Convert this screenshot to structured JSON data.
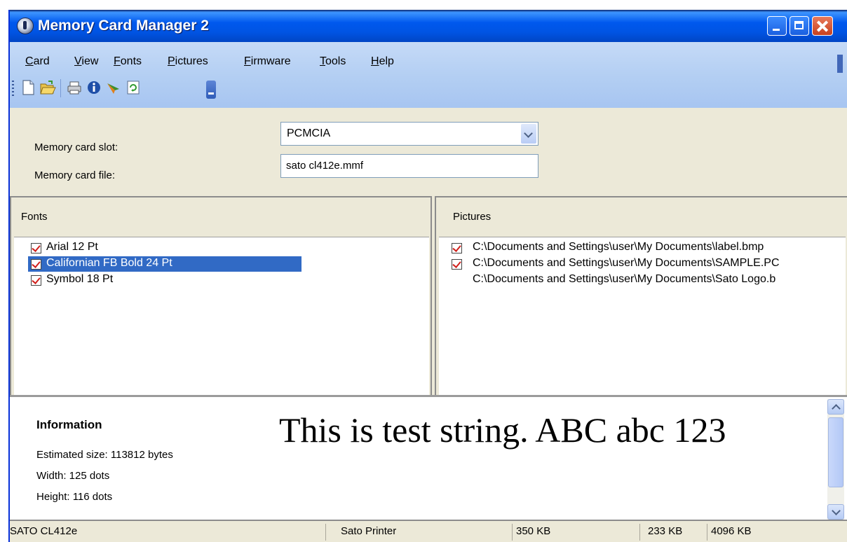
{
  "window": {
    "title": "Memory Card Manager 2"
  },
  "menu": [
    "Card",
    "View",
    "Fonts",
    "Pictures",
    "Firmware",
    "Tools",
    "Help"
  ],
  "toolbar": {
    "icons": [
      "new-document-icon",
      "open-folder-icon",
      "print-icon",
      "info-icon",
      "send-icon",
      "refresh-icon"
    ]
  },
  "form": {
    "slot_label": "Memory card slot:",
    "slot_value": "PCMCIA",
    "file_label": "Memory card file:",
    "file_value": "sato cl412e.mmf"
  },
  "fonts_pane": {
    "title": "Fonts",
    "items": [
      {
        "label": "Arial 12 Pt",
        "checked": true,
        "selected": false
      },
      {
        "label": "Californian FB Bold 24 Pt",
        "checked": true,
        "selected": true
      },
      {
        "label": "Symbol 18 Pt",
        "checked": true,
        "selected": false
      }
    ]
  },
  "pictures_pane": {
    "title": "Pictures",
    "items": [
      {
        "label": "C:\\Documents and Settings\\user\\My Documents\\label.bmp",
        "checked": true
      },
      {
        "label": "C:\\Documents and Settings\\user\\My Documents\\SAMPLE.PC",
        "checked": true
      },
      {
        "label": "C:\\Documents and Settings\\user\\My Documents\\Sato Logo.b",
        "checked": false
      }
    ]
  },
  "info": {
    "heading": "Information",
    "size": "Estimated size: 113812 bytes",
    "width": "Width: 125 dots",
    "height": "Height: 116 dots",
    "preview": "This is test string. ABC abc 123"
  },
  "status": {
    "printer_model": "SATO CL412e",
    "printer_name": "Sato Printer",
    "used": "350 KB",
    "free": "233 KB",
    "total": "4096 KB"
  },
  "colors": {
    "selection": "#316ac5",
    "titlebar": "#0054e3",
    "menubar": "#b4cff3",
    "checkmark": "#d0201c"
  }
}
